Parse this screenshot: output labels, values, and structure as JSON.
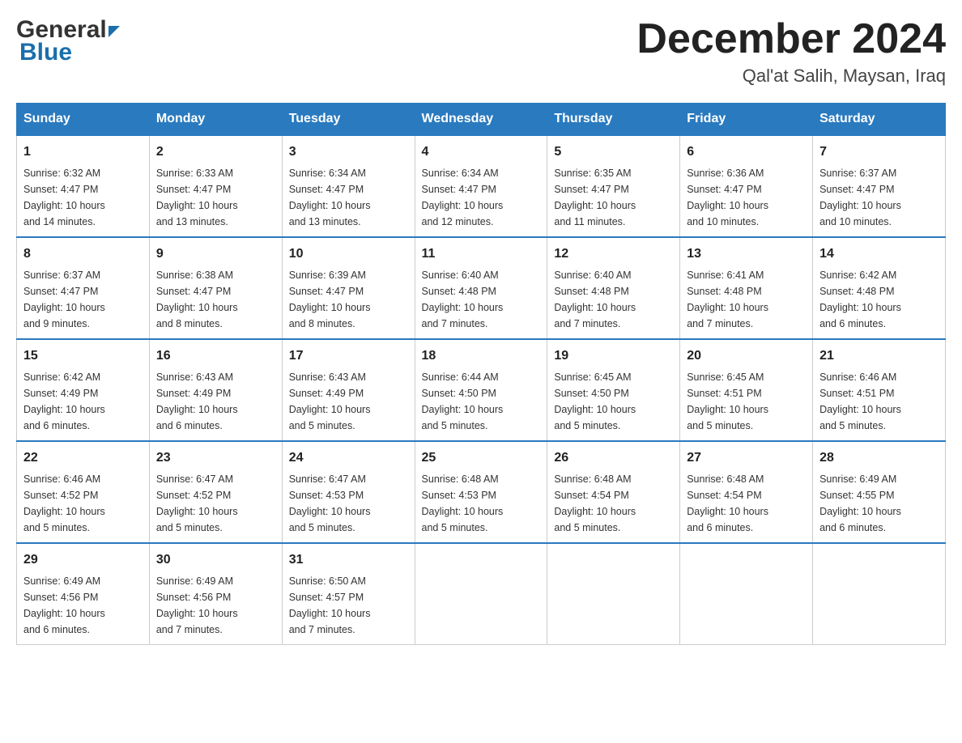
{
  "header": {
    "title": "December 2024",
    "subtitle": "Qal'at Salih, Maysan, Iraq",
    "logo_general": "General",
    "logo_blue": "Blue"
  },
  "weekdays": [
    "Sunday",
    "Monday",
    "Tuesday",
    "Wednesday",
    "Thursday",
    "Friday",
    "Saturday"
  ],
  "weeks": [
    [
      {
        "day": "1",
        "sunrise": "6:32 AM",
        "sunset": "4:47 PM",
        "daylight": "10 hours and 14 minutes."
      },
      {
        "day": "2",
        "sunrise": "6:33 AM",
        "sunset": "4:47 PM",
        "daylight": "10 hours and 13 minutes."
      },
      {
        "day": "3",
        "sunrise": "6:34 AM",
        "sunset": "4:47 PM",
        "daylight": "10 hours and 13 minutes."
      },
      {
        "day": "4",
        "sunrise": "6:34 AM",
        "sunset": "4:47 PM",
        "daylight": "10 hours and 12 minutes."
      },
      {
        "day": "5",
        "sunrise": "6:35 AM",
        "sunset": "4:47 PM",
        "daylight": "10 hours and 11 minutes."
      },
      {
        "day": "6",
        "sunrise": "6:36 AM",
        "sunset": "4:47 PM",
        "daylight": "10 hours and 10 minutes."
      },
      {
        "day": "7",
        "sunrise": "6:37 AM",
        "sunset": "4:47 PM",
        "daylight": "10 hours and 10 minutes."
      }
    ],
    [
      {
        "day": "8",
        "sunrise": "6:37 AM",
        "sunset": "4:47 PM",
        "daylight": "10 hours and 9 minutes."
      },
      {
        "day": "9",
        "sunrise": "6:38 AM",
        "sunset": "4:47 PM",
        "daylight": "10 hours and 8 minutes."
      },
      {
        "day": "10",
        "sunrise": "6:39 AM",
        "sunset": "4:47 PM",
        "daylight": "10 hours and 8 minutes."
      },
      {
        "day": "11",
        "sunrise": "6:40 AM",
        "sunset": "4:48 PM",
        "daylight": "10 hours and 7 minutes."
      },
      {
        "day": "12",
        "sunrise": "6:40 AM",
        "sunset": "4:48 PM",
        "daylight": "10 hours and 7 minutes."
      },
      {
        "day": "13",
        "sunrise": "6:41 AM",
        "sunset": "4:48 PM",
        "daylight": "10 hours and 7 minutes."
      },
      {
        "day": "14",
        "sunrise": "6:42 AM",
        "sunset": "4:48 PM",
        "daylight": "10 hours and 6 minutes."
      }
    ],
    [
      {
        "day": "15",
        "sunrise": "6:42 AM",
        "sunset": "4:49 PM",
        "daylight": "10 hours and 6 minutes."
      },
      {
        "day": "16",
        "sunrise": "6:43 AM",
        "sunset": "4:49 PM",
        "daylight": "10 hours and 6 minutes."
      },
      {
        "day": "17",
        "sunrise": "6:43 AM",
        "sunset": "4:49 PM",
        "daylight": "10 hours and 5 minutes."
      },
      {
        "day": "18",
        "sunrise": "6:44 AM",
        "sunset": "4:50 PM",
        "daylight": "10 hours and 5 minutes."
      },
      {
        "day": "19",
        "sunrise": "6:45 AM",
        "sunset": "4:50 PM",
        "daylight": "10 hours and 5 minutes."
      },
      {
        "day": "20",
        "sunrise": "6:45 AM",
        "sunset": "4:51 PM",
        "daylight": "10 hours and 5 minutes."
      },
      {
        "day": "21",
        "sunrise": "6:46 AM",
        "sunset": "4:51 PM",
        "daylight": "10 hours and 5 minutes."
      }
    ],
    [
      {
        "day": "22",
        "sunrise": "6:46 AM",
        "sunset": "4:52 PM",
        "daylight": "10 hours and 5 minutes."
      },
      {
        "day": "23",
        "sunrise": "6:47 AM",
        "sunset": "4:52 PM",
        "daylight": "10 hours and 5 minutes."
      },
      {
        "day": "24",
        "sunrise": "6:47 AM",
        "sunset": "4:53 PM",
        "daylight": "10 hours and 5 minutes."
      },
      {
        "day": "25",
        "sunrise": "6:48 AM",
        "sunset": "4:53 PM",
        "daylight": "10 hours and 5 minutes."
      },
      {
        "day": "26",
        "sunrise": "6:48 AM",
        "sunset": "4:54 PM",
        "daylight": "10 hours and 5 minutes."
      },
      {
        "day": "27",
        "sunrise": "6:48 AM",
        "sunset": "4:54 PM",
        "daylight": "10 hours and 6 minutes."
      },
      {
        "day": "28",
        "sunrise": "6:49 AM",
        "sunset": "4:55 PM",
        "daylight": "10 hours and 6 minutes."
      }
    ],
    [
      {
        "day": "29",
        "sunrise": "6:49 AM",
        "sunset": "4:56 PM",
        "daylight": "10 hours and 6 minutes."
      },
      {
        "day": "30",
        "sunrise": "6:49 AM",
        "sunset": "4:56 PM",
        "daylight": "10 hours and 7 minutes."
      },
      {
        "day": "31",
        "sunrise": "6:50 AM",
        "sunset": "4:57 PM",
        "daylight": "10 hours and 7 minutes."
      },
      null,
      null,
      null,
      null
    ]
  ],
  "labels": {
    "sunrise": "Sunrise:",
    "sunset": "Sunset:",
    "daylight": "Daylight:"
  }
}
